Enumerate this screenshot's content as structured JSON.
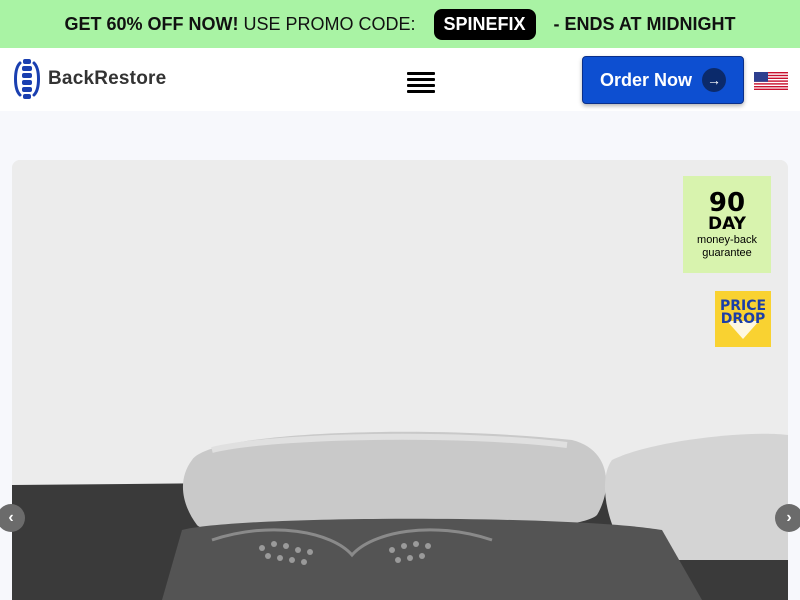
{
  "promo": {
    "lead": "GET 60% OFF NOW!",
    "mid": "USE PROMO CODE:",
    "code": "SPINEFIX",
    "tail": "- ENDS AT MIDNIGHT"
  },
  "header": {
    "brand": "BackRestore",
    "order_label": "Order Now",
    "order_icon": "→"
  },
  "badges": {
    "guarantee_number": "90",
    "guarantee_unit": "DAY",
    "guarantee_line1": "money-back",
    "guarantee_line2": "guarantee",
    "price_drop_line1": "PRICE",
    "price_drop_line2": "DROP"
  },
  "carousel": {
    "prev_icon": "‹",
    "next_icon": "›"
  },
  "colors": {
    "promo_bg": "#a9f3a4",
    "accent": "#0d4fd1",
    "badge_green": "#d8f3ae",
    "badge_yellow": "#f9d231"
  },
  "icons": [
    "spine-logo-icon",
    "hamburger-menu-icon",
    "arrow-right-icon",
    "us-flag-icon",
    "chevron-left-icon",
    "chevron-right-icon"
  ]
}
